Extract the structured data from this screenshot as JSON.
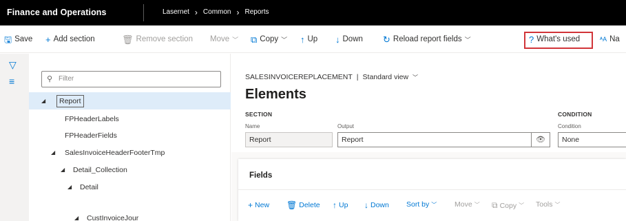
{
  "topbar": {
    "app_name": "Finance and Operations",
    "breadcrumbs": [
      "Lasernet",
      "Common",
      "Reports"
    ]
  },
  "toolbar": {
    "save": "Save",
    "add_section": "Add section",
    "remove_section": "Remove section",
    "move": "Move",
    "copy": "Copy",
    "up": "Up",
    "down": "Down",
    "reload": "Reload report fields",
    "whats_used": "What's used",
    "na": "Na"
  },
  "tree": {
    "filter_placeholder": "Filter",
    "nodes": [
      {
        "label": "Report",
        "expanded": true,
        "selected": true
      },
      {
        "label": "FPHeaderLabels"
      },
      {
        "label": "FPHeaderFields"
      },
      {
        "label": "SalesInvoiceHeaderFooterTmp",
        "expanded": true
      },
      {
        "label": "Detail_Collection",
        "expanded": true
      },
      {
        "label": "Detail",
        "expanded": true
      },
      {
        "label": "CustInvoiceJour"
      }
    ]
  },
  "main": {
    "report_name": "SALESINVOICEREPLACEMENT",
    "view_name": "Standard view",
    "title": "Elements",
    "section_header": "SECTION",
    "condition_header": "CONDITION",
    "name_label": "Name",
    "name_value": "Report",
    "output_label": "Output",
    "output_value": "Report",
    "condition_label": "Condition",
    "condition_value": "None"
  },
  "fields": {
    "title": "Fields",
    "toolbar": {
      "new": "New",
      "delete": "Delete",
      "up": "Up",
      "down": "Down",
      "sort_by": "Sort by",
      "move": "Move",
      "copy": "Copy",
      "tools": "Tools"
    }
  },
  "colors": {
    "accent": "#0078d4",
    "highlight_border": "#d13438",
    "selection": "#deecf9",
    "topbar": "#000000"
  }
}
